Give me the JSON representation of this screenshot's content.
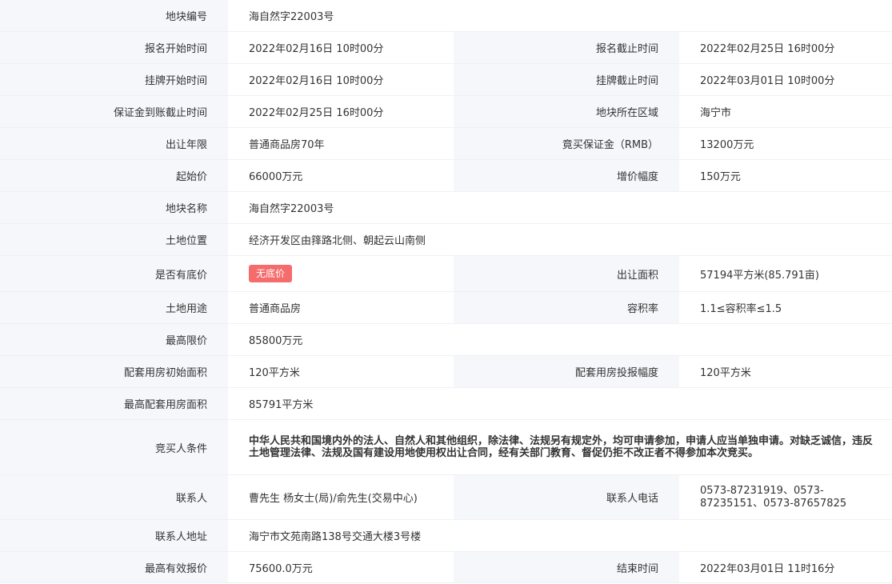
{
  "rows": {
    "plot_no": {
      "label": "地块编号",
      "value": "海自然字22003号"
    },
    "signup_start": {
      "label": "报名开始时间",
      "value": "2022年02月16日 10时00分"
    },
    "signup_end": {
      "label": "报名截止时间",
      "value": "2022年02月25日 16时00分"
    },
    "listing_start": {
      "label": "挂牌开始时间",
      "value": "2022年02月16日 10时00分"
    },
    "listing_end": {
      "label": "挂牌截止时间",
      "value": "2022年03月01日 10时00分"
    },
    "deposit_deadline": {
      "label": "保证金到账截止时间",
      "value": "2022年02月25日 16时00分"
    },
    "region": {
      "label": "地块所在区域",
      "value": "海宁市"
    },
    "term": {
      "label": "出让年限",
      "value": "普通商品房70年"
    },
    "deposit": {
      "label": "竟买保证金（RMB）",
      "value": "13200万元"
    },
    "start_price": {
      "label": "起始价",
      "value": "66000万元"
    },
    "increment": {
      "label": "增价幅度",
      "value": "150万元"
    },
    "plot_name": {
      "label": "地块名称",
      "value": "海自然字22003号"
    },
    "location": {
      "label": "土地位置",
      "value": "经济开发区由箨路北侧、朝起云山南侧"
    },
    "reserve": {
      "label": "是否有底价",
      "value": "无底价"
    },
    "area": {
      "label": "出让面积",
      "value": "57194平方米(85.791亩)"
    },
    "usage": {
      "label": "土地用途",
      "value": "普通商品房"
    },
    "far": {
      "label": "容积率",
      "value": "1.1≤容积率≤1.5"
    },
    "max_price": {
      "label": "最高限价",
      "value": "85800万元"
    },
    "housing_init": {
      "label": "配套用房初始面积",
      "value": "120平方米"
    },
    "housing_step": {
      "label": "配套用房投报幅度",
      "value": "120平方米"
    },
    "housing_max": {
      "label": "最高配套用房面积",
      "value": "85791平方米"
    },
    "conditions": {
      "label": "竞买人条件",
      "value": "中华人民共和国境内外的法人、自然人和其他组织，除法律、法规另有规定外，均可申请参加，申请人应当单独申请。对缺乏诚信，违反土地管理法律、法规及国有建设用地使用权出让合同，经有关部门教育、督促仍拒不改正者不得参加本次竞买。"
    },
    "contact": {
      "label": "联系人",
      "value": "曹先生 杨女士(局)/俞先生(交易中心)"
    },
    "phone": {
      "label": "联系人电话",
      "value": "0573-87231919、0573-87235151、0573-87657825"
    },
    "address": {
      "label": "联系人地址",
      "value": "海宁市文苑南路138号交通大楼3号楼"
    },
    "best_bid": {
      "label": "最高有效报价",
      "value": "75600.0万元"
    },
    "end_time": {
      "label": "结束时间",
      "value": "2022年03月01日 11时16分"
    }
  },
  "colors": {
    "label_bg": "#f5f7fa",
    "border": "#eef0f3",
    "badge_bg": "#f56c6c",
    "text": "#333333"
  }
}
